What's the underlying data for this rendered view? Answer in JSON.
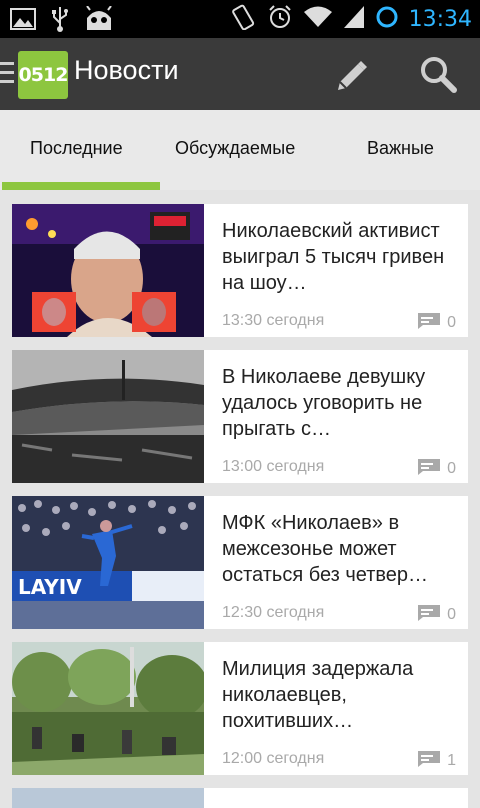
{
  "status_bar": {
    "time": "13:34",
    "icons_left": [
      "image-icon",
      "usb-icon",
      "android-icon"
    ],
    "icons_right": [
      "rotate-icon",
      "alarm-icon",
      "wifi-icon",
      "signal-icon",
      "sync-icon"
    ]
  },
  "action_bar": {
    "logo_text": "0512",
    "title": "Новости",
    "actions": [
      "edit-icon",
      "search-icon"
    ]
  },
  "tabs": [
    {
      "label": "Последние",
      "selected": true
    },
    {
      "label": "Обсуждаемые",
      "selected": false
    },
    {
      "label": "Важные",
      "selected": false
    }
  ],
  "news": [
    {
      "title": "Николаевский активист выиграл 5 тысяч гривен на шоу…",
      "time": "13:30 сегодня",
      "comments": "0"
    },
    {
      "title": "В Николаеве девушку удалось уговорить не прыгать с…",
      "time": "13:00 сегодня",
      "comments": "0"
    },
    {
      "title": "МФК «Николаев» в межсезонье может остаться без четвер…",
      "time": "12:30 сегодня",
      "comments": "0"
    },
    {
      "title": "Милиция задержала николаевцев, похитивших…",
      "time": "12:00 сегодня",
      "comments": "1"
    }
  ],
  "colors": {
    "accent_green": "#8dc63f",
    "action_bar": "#3a3a3a",
    "status_time": "#2fb6ff",
    "meta_gray": "#a9a9a9"
  }
}
